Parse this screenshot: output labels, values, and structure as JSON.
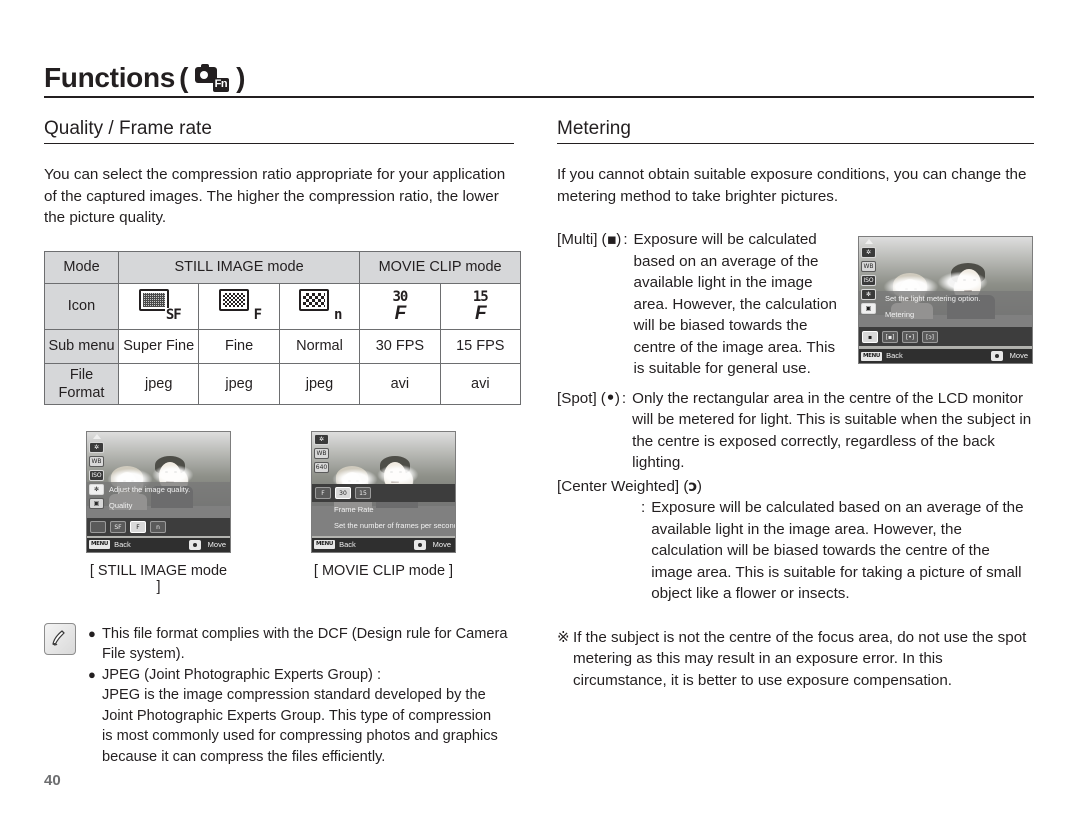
{
  "page": {
    "number": "40",
    "chapter_title": "Functions",
    "chapter_icon_label": "Fn"
  },
  "left_column": {
    "section_title": "Quality / Frame rate",
    "intro": "You can select the compression ratio appropriate for your application of the captured images. The higher the compression ratio, the lower the picture quality.",
    "table": {
      "row_labels": [
        "Mode",
        "Icon",
        "Sub menu",
        "File Format"
      ],
      "mode_headers": [
        "STILL IMAGE mode",
        "MOVIE CLIP mode"
      ],
      "icons": [
        "SF",
        "F",
        "n",
        "30",
        "15"
      ],
      "sub_menu": [
        "Super Fine",
        "Fine",
        "Normal",
        "30 FPS",
        "15 FPS"
      ],
      "file_format": [
        "jpeg",
        "jpeg",
        "jpeg",
        "avi",
        "avi"
      ]
    },
    "lcd_still": {
      "info_line1": "Adjust the image quality.",
      "info_line2": "Quality",
      "resolution_badge": "",
      "back_chip": "MENU",
      "back_label": "Back",
      "move_label": "Move"
    },
    "lcd_movie": {
      "info_line1": "Frame Rate",
      "info_line2": "Set the number of frames per second for movies.",
      "resolution_badge": "640",
      "back_chip": "MENU",
      "back_label": "Back",
      "move_label": "Move"
    },
    "lcd_captions": [
      "[ STILL IMAGE mode ]",
      "[ MOVIE CLIP mode ]"
    ],
    "notes": [
      {
        "lines": [
          "This file format complies with the DCF (Design rule for Camera",
          "File system)."
        ]
      },
      {
        "lines": [
          "JPEG (Joint Photographic Experts Group) :",
          "JPEG is the image compression standard developed by the",
          "Joint Photographic Experts Group. This type of compression",
          "is most commonly used for compressing photos and graphics",
          "because it can compress the files efficiently."
        ]
      }
    ]
  },
  "right_column": {
    "section_title": "Metering",
    "intro": "If you cannot obtain suitable exposure conditions, you can change the metering method to take brighter pictures.",
    "definitions": [
      {
        "term": "[Multi]",
        "symbol": "▪",
        "colon": ":",
        "description": "Exposure will be calculated based on an average of the available light in the image area. However, the calculation will be biased towards the centre of the image area. This is suitable for general use."
      },
      {
        "term": "[Spot]",
        "symbol": "•",
        "colon": ":",
        "description": "Only the rectangular area in the centre of the LCD monitor will be metered for light. This is suitable when the subject in the centre is exposed correctly, regardless of the back lighting."
      },
      {
        "term": "[Center Weighted]",
        "symbol": "ɔ",
        "colon": ":",
        "description": "Exposure will be calculated based on an average of the available light in the image area. However, the calculation will be biased towards the centre of the image area. This is suitable for taking a picture of small object like a flower or insects."
      }
    ],
    "asterisk_mark": "※",
    "asterisk_note": "If the subject is not the centre of the focus area, do not use the spot metering as this may result in an exposure error. In this circumstance, it is better to use exposure compensation.",
    "lcd_metering": {
      "info_line1": "Set the light metering option.",
      "info_line2": "Metering",
      "options": [
        "▪",
        "[▪]",
        "[•]",
        "[ɔ]"
      ],
      "back_chip": "MENU",
      "back_label": "Back",
      "move_label": "Move"
    }
  },
  "colors": {
    "text": "#231f20",
    "table_header_bg": "#d6d7d9",
    "rule": "#231f20",
    "page_number": "#6d6e70"
  }
}
